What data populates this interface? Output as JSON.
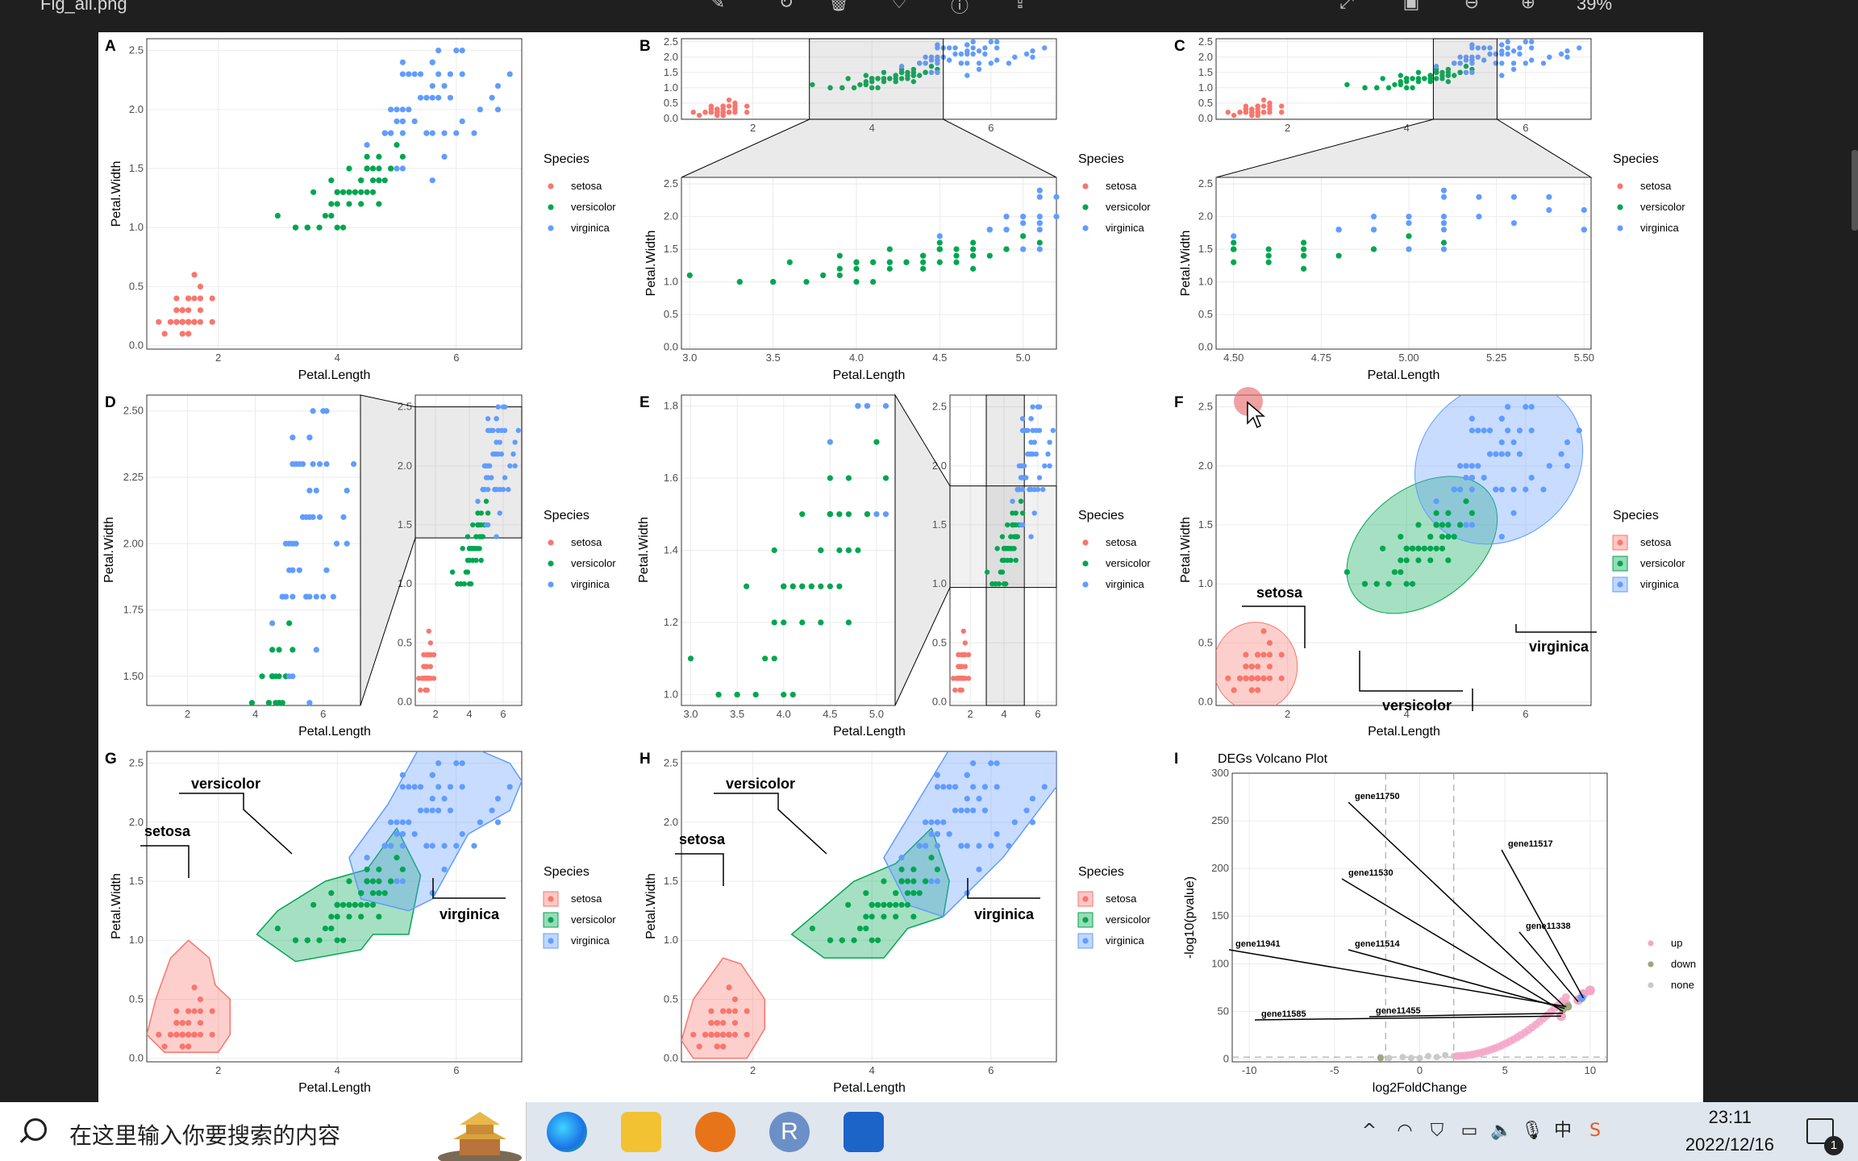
{
  "window": {
    "title": "Fig_all.png",
    "zoom": "39%"
  },
  "colors": {
    "setosa": "#F8766D",
    "versicolor": "#00A650",
    "virginica": "#619CFF",
    "up": "#F4A6C8",
    "down": "#9BA77B",
    "none": "#C9C9C9"
  },
  "panels": {
    "A": {
      "label": "A",
      "xlabel": "Petal.Length",
      "ylabel": "Petal.Width",
      "xticks": [
        "2",
        "4",
        "6"
      ],
      "yticks": [
        "0.0",
        "0.5",
        "1.0",
        "1.5",
        "2.0",
        "2.5"
      ]
    },
    "B": {
      "label": "B",
      "xlabel": "Petal.Length",
      "ylabel": "Petal.Width",
      "top_xticks": [
        "2",
        "4",
        "6"
      ],
      "top_yticks": [
        "0.0",
        "0.5",
        "1.0",
        "1.5",
        "2.0",
        "2.5"
      ],
      "xticks": [
        "3.0",
        "3.5",
        "4.0",
        "4.5",
        "5.0"
      ],
      "yticks": [
        "0.0",
        "0.5",
        "1.0",
        "1.5",
        "2.0",
        "2.5"
      ]
    },
    "C": {
      "label": "C",
      "xlabel": "Petal.Length",
      "ylabel": "Petal.Width",
      "top_xticks": [
        "2",
        "4",
        "6"
      ],
      "top_yticks": [
        "0.0",
        "0.5",
        "1.0",
        "1.5",
        "2.0",
        "2.5"
      ],
      "xticks": [
        "4.50",
        "4.75",
        "5.00",
        "5.25",
        "5.50"
      ],
      "yticks": [
        "0.0",
        "0.5",
        "1.0",
        "1.5",
        "2.0",
        "2.5"
      ]
    },
    "D": {
      "label": "D",
      "xlabel": "Petal.Length",
      "ylabel": "Petal.Width",
      "xticks": [
        "2",
        "4",
        "6"
      ],
      "yticks": [
        "1.50",
        "1.75",
        "2.00",
        "2.25",
        "2.50"
      ],
      "inset_xticks": [
        "2",
        "4",
        "6"
      ],
      "inset_yticks": [
        "0.0",
        "0.5",
        "1.0",
        "1.5",
        "2.0",
        "2.5"
      ]
    },
    "E": {
      "label": "E",
      "xlabel": "Petal.Length",
      "ylabel": "Petal.Width",
      "xticks": [
        "3.0",
        "3.5",
        "4.0",
        "4.5",
        "5.0"
      ],
      "yticks": [
        "1.0",
        "1.2",
        "1.4",
        "1.6",
        "1.8"
      ],
      "inset_xticks": [
        "2",
        "4",
        "6"
      ],
      "inset_yticks": [
        "0.0",
        "0.5",
        "1.0",
        "1.5",
        "2.0",
        "2.5"
      ]
    },
    "F": {
      "label": "F",
      "xlabel": "Petal.Length",
      "ylabel": "Petal.Width",
      "xticks": [
        "2",
        "4",
        "6"
      ],
      "yticks": [
        "0.0",
        "0.5",
        "1.0",
        "1.5",
        "2.0",
        "2.5"
      ],
      "annotations": [
        "setosa",
        "versicolor",
        "virginica"
      ]
    },
    "G": {
      "label": "G",
      "xlabel": "Petal.Length",
      "ylabel": "Petal.Width",
      "xticks": [
        "2",
        "4",
        "6"
      ],
      "yticks": [
        "0.0",
        "0.5",
        "1.0",
        "1.5",
        "2.0",
        "2.5"
      ],
      "annotations": [
        "versicolor",
        "setosa",
        "virginica"
      ]
    },
    "H": {
      "label": "H",
      "xlabel": "Petal.Length",
      "ylabel": "Petal.Width",
      "xticks": [
        "2",
        "4",
        "6"
      ],
      "yticks": [
        "0.0",
        "0.5",
        "1.0",
        "1.5",
        "2.0",
        "2.5"
      ],
      "annotations": [
        "versicolor",
        "setosa",
        "virginica"
      ]
    },
    "I": {
      "label": "I",
      "title": "DEGs Volcano Plot",
      "xlabel": "log2FoldChange",
      "ylabel": "-log10(pvalue)",
      "xticks": [
        "-10",
        "-5",
        "0",
        "5",
        "10"
      ],
      "yticks": [
        "0",
        "50",
        "100",
        "150",
        "200",
        "250",
        "300"
      ],
      "genes": [
        "gene11750",
        "gene11517",
        "gene11530",
        "gene11338",
        "gene11941",
        "gene11514",
        "gene11585",
        "gene11455"
      ],
      "legend": [
        "up",
        "down",
        "none"
      ]
    }
  },
  "legend": {
    "title": "Species",
    "items": [
      "setosa",
      "versicolor",
      "virginica"
    ]
  },
  "chart_data": {
    "type": "scatter",
    "title": "",
    "xlabel": "Petal.Length",
    "ylabel": "Petal.Width",
    "xlim": [
      1,
      6.9
    ],
    "ylim": [
      0,
      2.5
    ],
    "series": [
      {
        "name": "setosa",
        "color": "#F8766D",
        "points": [
          [
            1.4,
            0.2
          ],
          [
            1.4,
            0.2
          ],
          [
            1.3,
            0.2
          ],
          [
            1.5,
            0.2
          ],
          [
            1.4,
            0.2
          ],
          [
            1.7,
            0.4
          ],
          [
            1.4,
            0.3
          ],
          [
            1.5,
            0.2
          ],
          [
            1.4,
            0.2
          ],
          [
            1.5,
            0.1
          ],
          [
            1.5,
            0.2
          ],
          [
            1.6,
            0.2
          ],
          [
            1.4,
            0.1
          ],
          [
            1.1,
            0.1
          ],
          [
            1.2,
            0.2
          ],
          [
            1.5,
            0.4
          ],
          [
            1.3,
            0.4
          ],
          [
            1.4,
            0.3
          ],
          [
            1.7,
            0.3
          ],
          [
            1.5,
            0.3
          ],
          [
            1.7,
            0.2
          ],
          [
            1.5,
            0.4
          ],
          [
            1.0,
            0.2
          ],
          [
            1.7,
            0.5
          ],
          [
            1.9,
            0.2
          ],
          [
            1.6,
            0.2
          ],
          [
            1.6,
            0.4
          ],
          [
            1.5,
            0.2
          ],
          [
            1.4,
            0.2
          ],
          [
            1.6,
            0.2
          ],
          [
            1.6,
            0.2
          ],
          [
            1.5,
            0.4
          ],
          [
            1.5,
            0.1
          ],
          [
            1.4,
            0.2
          ],
          [
            1.5,
            0.2
          ],
          [
            1.2,
            0.2
          ],
          [
            1.3,
            0.2
          ],
          [
            1.4,
            0.1
          ],
          [
            1.3,
            0.2
          ],
          [
            1.5,
            0.2
          ],
          [
            1.3,
            0.3
          ],
          [
            1.3,
            0.3
          ],
          [
            1.3,
            0.2
          ],
          [
            1.6,
            0.6
          ],
          [
            1.9,
            0.4
          ],
          [
            1.4,
            0.3
          ],
          [
            1.6,
            0.2
          ],
          [
            1.4,
            0.2
          ],
          [
            1.5,
            0.2
          ],
          [
            1.4,
            0.2
          ]
        ]
      },
      {
        "name": "versicolor",
        "color": "#00A650",
        "points": [
          [
            4.7,
            1.4
          ],
          [
            4.5,
            1.5
          ],
          [
            4.9,
            1.5
          ],
          [
            4.0,
            1.3
          ],
          [
            4.6,
            1.5
          ],
          [
            4.5,
            1.3
          ],
          [
            4.7,
            1.6
          ],
          [
            3.3,
            1.0
          ],
          [
            4.6,
            1.3
          ],
          [
            3.9,
            1.4
          ],
          [
            3.5,
            1.0
          ],
          [
            4.2,
            1.5
          ],
          [
            4.0,
            1.0
          ],
          [
            4.7,
            1.4
          ],
          [
            3.6,
            1.3
          ],
          [
            4.4,
            1.4
          ],
          [
            4.5,
            1.5
          ],
          [
            4.1,
            1.0
          ],
          [
            4.5,
            1.5
          ],
          [
            3.9,
            1.1
          ],
          [
            4.8,
            1.8
          ],
          [
            4.0,
            1.3
          ],
          [
            4.9,
            1.5
          ],
          [
            4.7,
            1.2
          ],
          [
            4.3,
            1.3
          ],
          [
            4.4,
            1.4
          ],
          [
            4.8,
            1.4
          ],
          [
            5.0,
            1.7
          ],
          [
            4.5,
            1.5
          ],
          [
            3.5,
            1.0
          ],
          [
            3.8,
            1.1
          ],
          [
            3.7,
            1.0
          ],
          [
            3.9,
            1.2
          ],
          [
            5.1,
            1.6
          ],
          [
            4.5,
            1.5
          ],
          [
            4.5,
            1.6
          ],
          [
            4.7,
            1.5
          ],
          [
            4.4,
            1.3
          ],
          [
            4.1,
            1.3
          ],
          [
            4.0,
            1.3
          ],
          [
            4.4,
            1.2
          ],
          [
            4.6,
            1.4
          ],
          [
            4.0,
            1.2
          ],
          [
            3.3,
            1.0
          ],
          [
            4.2,
            1.3
          ],
          [
            4.2,
            1.2
          ],
          [
            4.2,
            1.3
          ],
          [
            4.3,
            1.3
          ],
          [
            3.0,
            1.1
          ],
          [
            4.1,
            1.3
          ]
        ]
      },
      {
        "name": "virginica",
        "color": "#619CFF",
        "points": [
          [
            6.0,
            2.5
          ],
          [
            5.1,
            1.9
          ],
          [
            5.9,
            2.1
          ],
          [
            5.6,
            1.8
          ],
          [
            5.8,
            2.2
          ],
          [
            6.6,
            2.1
          ],
          [
            4.5,
            1.7
          ],
          [
            6.3,
            1.8
          ],
          [
            5.8,
            1.8
          ],
          [
            6.1,
            2.5
          ],
          [
            5.1,
            2.0
          ],
          [
            5.3,
            1.9
          ],
          [
            5.5,
            2.1
          ],
          [
            5.0,
            2.0
          ],
          [
            5.1,
            2.4
          ],
          [
            5.3,
            2.3
          ],
          [
            5.5,
            1.8
          ],
          [
            6.7,
            2.2
          ],
          [
            6.9,
            2.3
          ],
          [
            5.0,
            1.5
          ],
          [
            5.7,
            2.3
          ],
          [
            4.9,
            2.0
          ],
          [
            6.7,
            2.0
          ],
          [
            4.9,
            1.8
          ],
          [
            5.7,
            2.1
          ],
          [
            6.0,
            1.8
          ],
          [
            4.8,
            1.8
          ],
          [
            4.9,
            1.8
          ],
          [
            5.6,
            2.1
          ],
          [
            5.8,
            1.6
          ],
          [
            6.1,
            1.9
          ],
          [
            6.4,
            2.0
          ],
          [
            5.6,
            2.2
          ],
          [
            5.1,
            1.5
          ],
          [
            5.6,
            1.4
          ],
          [
            6.1,
            2.3
          ],
          [
            5.6,
            2.4
          ],
          [
            5.5,
            1.8
          ],
          [
            4.8,
            1.8
          ],
          [
            5.4,
            2.1
          ],
          [
            5.6,
            2.4
          ],
          [
            5.1,
            2.3
          ],
          [
            5.1,
            1.9
          ],
          [
            5.9,
            2.3
          ],
          [
            5.7,
            2.5
          ],
          [
            5.2,
            2.3
          ],
          [
            5.0,
            1.9
          ],
          [
            5.2,
            2.0
          ],
          [
            5.4,
            2.3
          ],
          [
            5.1,
            1.8
          ]
        ]
      }
    ]
  },
  "taskbar": {
    "search_placeholder": "在这里输入你要搜索的内容",
    "time": "23:11",
    "date": "2022/12/16",
    "notification_count": "1",
    "ime": "中"
  }
}
